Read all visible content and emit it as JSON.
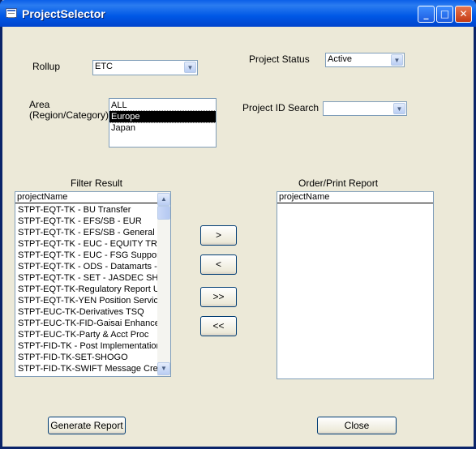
{
  "window": {
    "title": "ProjectSelector"
  },
  "title_buttons": {
    "minimize": "_",
    "maximize": "□",
    "close": "✕"
  },
  "rollup": {
    "label": "Rollup",
    "value": "ETC"
  },
  "project_status": {
    "label": "Project Status",
    "value": "Active"
  },
  "area": {
    "label_line1": "Area",
    "label_line2": "(Region/Category)",
    "items": [
      "ALL",
      "Europe",
      "Japan"
    ],
    "selected_index": 1
  },
  "project_id_search": {
    "label": "Project ID Search",
    "value": ""
  },
  "filter_result": {
    "label": "Filter Result",
    "header": "projectName",
    "rows": [
      "STPT-EQT-TK - BU Transfer",
      "STPT-EQT-TK - EFS/SB - EUR",
      "STPT-EQT-TK - EFS/SB - General Su",
      "STPT-EQT-TK - EUC - EQUITY TRAD",
      "STPT-EQT-TK - EUC - FSG Support",
      "STPT-EQT-TK - ODS - Datamarts - C",
      "STPT-EQT-TK - SET - JASDEC SHOG",
      "STPT-EQT-TK-Regulatory Report Up",
      "STPT-EQT-TK-YEN Position Service",
      "STPT-EUC-TK-Derivatives TSQ",
      "STPT-EUC-TK-FID-Gaisai Enhanceme",
      "STPT-EUC-TK-Party & Acct Proc",
      "STPT-FID-TK - Post Implementation",
      "STPT-FID-TK-SET-SHOGO",
      "STPT-FID-TK-SWIFT Message Creat"
    ]
  },
  "order_report": {
    "label": "Order/Print Report",
    "header": "projectName"
  },
  "move_buttons": {
    "add": ">",
    "remove": "<",
    "add_all": ">>",
    "remove_all": "<<"
  },
  "footer": {
    "generate": "Generate Report",
    "close": "Close"
  }
}
